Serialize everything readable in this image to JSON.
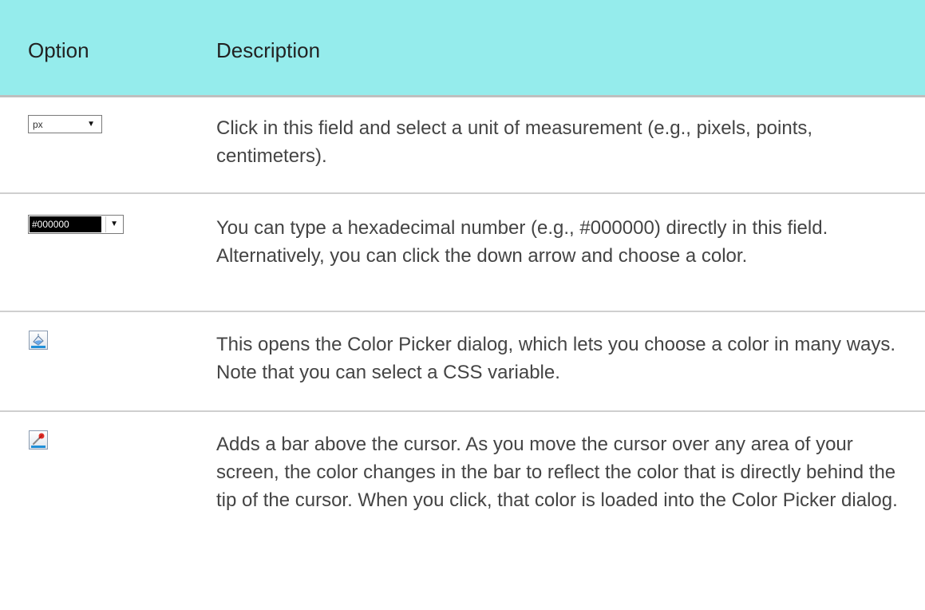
{
  "header": {
    "option_label": "Option",
    "description_label": "Description"
  },
  "rows": [
    {
      "control": "unit-dropdown",
      "control_value": "px",
      "description": "Click in this field and select a unit of measurement (e.g., pixels, points, centimeters)."
    },
    {
      "control": "color-hex-dropdown",
      "control_value": "#000000",
      "description": "You can type a hexadecimal number (e.g., #000000) directly in this field. Alternatively, you can click the down arrow and choose a color."
    },
    {
      "control": "color-picker-icon",
      "description": "This opens the Color Picker dialog, which lets you choose a color in many ways. Note that you can select a CSS variable."
    },
    {
      "control": "eyedropper-icon",
      "description": "Adds a bar above the cursor. As you move the cursor over any area of your screen, the color changes in the bar to reflect the color that is directly behind the tip of the cursor. When you click, that color is loaded into the Color Picker dialog."
    }
  ],
  "colors": {
    "header_bg": "#95ecec",
    "text": "#444444"
  }
}
